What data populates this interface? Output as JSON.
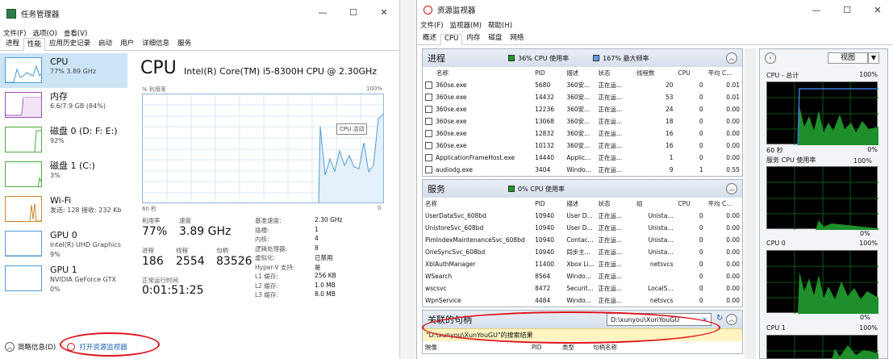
{
  "task_manager": {
    "title": "任务管理器",
    "window_controls": [
      "—",
      "☐",
      "✕"
    ],
    "menu": [
      "文件(F)",
      "选项(O)",
      "查看(V)"
    ],
    "tabs": [
      "进程",
      "性能",
      "应用历史记录",
      "启动",
      "用户",
      "详细信息",
      "服务"
    ],
    "active_tab": "性能",
    "sidebar": [
      {
        "name": "CPU",
        "detail": "77% 3.89 GHz",
        "color": "#4d9bd6"
      },
      {
        "name": "内存",
        "detail": "6.6/7.9 GB (84%)",
        "color": "#9b4db8"
      },
      {
        "name": "磁盘 0 (D: F: E:)",
        "detail": "92%",
        "color": "#4daa3e"
      },
      {
        "name": "磁盘 1 (C:)",
        "detail": "3%",
        "color": "#4daa3e"
      },
      {
        "name": "Wi-Fi",
        "detail": "发送: 128 接收: 232 Kb",
        "color": "#c8852c"
      },
      {
        "name": "GPU 0",
        "detail1": "Intel(R) UHD Graphics",
        "detail2": "9%",
        "color": "#4d9bd6"
      },
      {
        "name": "GPU 1",
        "detail1": "NVIDIA GeForce GTX",
        "detail2": "0%",
        "color": "#4d9bd6"
      }
    ],
    "cpu": {
      "title": "CPU",
      "model": "Intel(R) Core(TM) i5-8300H CPU @ 2.30GHz",
      "graph_label": "% 利用率",
      "graph_max": "100%",
      "graph_time": "60 秒",
      "graph_min": "0",
      "tooltip": "CPU 活动",
      "utilization_label": "利用率",
      "utilization": "77%",
      "speed_label": "速度",
      "speed": "3.89 GHz",
      "processes_label": "进程",
      "processes": "186",
      "threads_label": "线程",
      "threads": "2554",
      "handles_label": "句柄",
      "handles": "83526",
      "uptime_label": "正常运行时间",
      "uptime": "0:01:51:25",
      "specs": [
        {
          "k": "基准速度:",
          "v": "2.30 GHz"
        },
        {
          "k": "插槽:",
          "v": "1"
        },
        {
          "k": "内核:",
          "v": "4"
        },
        {
          "k": "逻辑处理器:",
          "v": "8"
        },
        {
          "k": "虚拟化:",
          "v": "已禁用"
        },
        {
          "k": "Hyper-V 支持:",
          "v": "是"
        },
        {
          "k": "L1 缓存:",
          "v": "256 KB"
        },
        {
          "k": "L2 缓存:",
          "v": "1.0 MB"
        },
        {
          "k": "L3 缓存:",
          "v": "8.0 MB"
        }
      ]
    },
    "footer": {
      "brief": "简略信息(D)",
      "open_resmon": "打开资源监视器"
    }
  },
  "resource_monitor": {
    "title": "资源监视器",
    "window_controls": [
      "—",
      "☐",
      "✕"
    ],
    "menu": [
      "文件(F)",
      "监视器(M)",
      "帮助(H)"
    ],
    "tabs": [
      "概述",
      "CPU",
      "内存",
      "磁盘",
      "网络"
    ],
    "active_tab": "CPU",
    "processes": {
      "title": "进程",
      "legend1": "36% CPU 使用率",
      "legend1_color": "#1a9a2a",
      "legend2": "167% 最大频率",
      "legend2_color": "#5aa0e6",
      "columns": [
        "名称",
        "PID",
        "描述",
        "状态",
        "线程数",
        "CPU",
        "平均 C..."
      ],
      "rows": [
        [
          "360se.exe",
          "5680",
          "360安...",
          "正在运...",
          "20",
          "0",
          "0.01"
        ],
        [
          "360se.exe",
          "14432",
          "360安...",
          "正在运...",
          "53",
          "0",
          "0.01"
        ],
        [
          "360se.exe",
          "12236",
          "360安...",
          "正在运...",
          "24",
          "0",
          "0.00"
        ],
        [
          "360se.exe",
          "13068",
          "360安...",
          "正在运...",
          "18",
          "0",
          "0.00"
        ],
        [
          "360se.exe",
          "12832",
          "360安...",
          "正在运...",
          "16",
          "0",
          "0.00"
        ],
        [
          "360se.exe",
          "10132",
          "360安...",
          "正在运...",
          "16",
          "0",
          "0.00"
        ],
        [
          "ApplicationFrameHost.exe",
          "14440",
          "Applic...",
          "正在运...",
          "1",
          "0",
          "0.00"
        ],
        [
          "audiodg.exe",
          "3404",
          "Windo...",
          "正在运...",
          "9",
          "1",
          "0.55"
        ]
      ]
    },
    "services": {
      "title": "服务",
      "legend1": "0% CPU 使用率",
      "legend1_color": "#1a9a2a",
      "columns": [
        "名称",
        "PID",
        "描述",
        "状态",
        "组",
        "CPU",
        "平均 C..."
      ],
      "rows": [
        [
          "UserDataSvc_608bd",
          "10940",
          "User D...",
          "正在运...",
          "Unista...",
          "0",
          "0.00"
        ],
        [
          "UnistoreSvc_608bd",
          "10940",
          "User D...",
          "正在运...",
          "Unista...",
          "0",
          "0.00"
        ],
        [
          "PimIndexMaintenanceSvc_608bd",
          "10940",
          "Contac...",
          "正在运...",
          "Unista...",
          "0",
          "0.00"
        ],
        [
          "OneSyncSvc_608bd",
          "10940",
          "同步主...",
          "正在运...",
          "Unista...",
          "0",
          "0.00"
        ],
        [
          "XblAuthManager",
          "11400",
          "Xbox Li...",
          "正在运...",
          "netsvcs",
          "0",
          "0.00"
        ],
        [
          "WSearch",
          "8564",
          "Windo...",
          "正在运...",
          "",
          "0",
          "0.00"
        ],
        [
          "wscsvc",
          "8472",
          "Securit...",
          "正在运...",
          "LocalS...",
          "0",
          "0.00"
        ],
        [
          "WpnService",
          "4484",
          "Windo...",
          "正在运...",
          "netsvcs",
          "0",
          "0.00"
        ]
      ]
    },
    "handles": {
      "title": "关联的句柄",
      "search_value": "D:\\xunyou\\XunYouGU",
      "result": "\"D:\\xunyou\\XunYouGU\"的搜索结果",
      "columns": [
        "映像",
        "PID",
        "类型",
        "句柄名称"
      ]
    },
    "right_panel": {
      "view_label": "视图",
      "graphs": [
        {
          "title": "CPU - 总计",
          "max": "100%",
          "time": "60 秒",
          "min": "0%"
        },
        {
          "title": "服务 CPU 使用率",
          "max": "100%",
          "min": "0%"
        },
        {
          "title": "CPU 0",
          "max": "100%",
          "min": "0%"
        },
        {
          "title": "CPU 1",
          "max": "100%"
        }
      ]
    }
  }
}
